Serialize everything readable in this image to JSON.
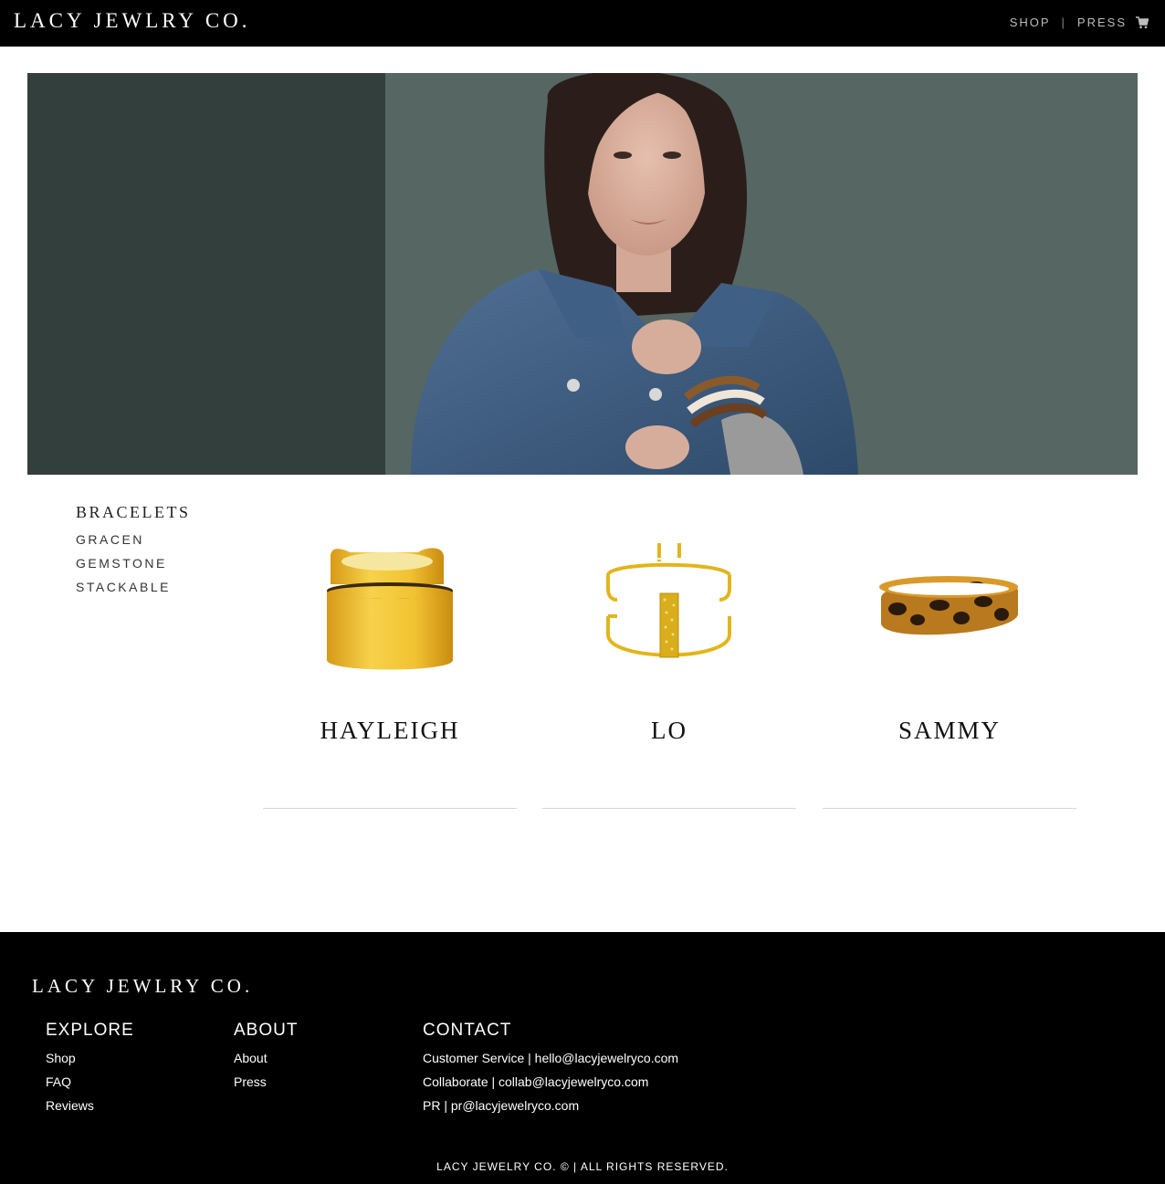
{
  "header": {
    "brand": "LACY JEWLRY CO.",
    "nav": {
      "shop": "SHOP",
      "separator": "|",
      "press": "PRESS",
      "cart_icon": "cart-icon"
    }
  },
  "hero": {
    "image": "woman-in-denim-jacket-wearing-bracelets",
    "colors": {
      "left_panel": "#333f3c",
      "background": "#566663"
    }
  },
  "categories": {
    "title": "BRACELETS",
    "items": [
      "GRACEN",
      "GEMSTONE",
      "STACKABLE"
    ]
  },
  "products": [
    {
      "name": "HAYLEIGH",
      "image": "gold-double-cuff-bracelet"
    },
    {
      "name": "LO",
      "image": "gold-open-bar-cuff-bracelet"
    },
    {
      "name": "SAMMY",
      "image": "tortoiseshell-cuff-bracelet"
    }
  ],
  "footer": {
    "brand": "LACY JEWLRY CO.",
    "explore": {
      "heading": "EXPLORE",
      "links": [
        "Shop",
        "FAQ",
        "Reviews"
      ]
    },
    "about": {
      "heading": "ABOUT",
      "links": [
        "About",
        "Press"
      ]
    },
    "contact": {
      "heading": "CONTACT",
      "links": [
        "Customer Service | hello@lacyjewelryco.com",
        "Collaborate | collab@lacyjewelryco.com",
        "PR | pr@lacyjewelryco.com"
      ]
    },
    "copyright": "LACY JEWELRY CO. © | ALL RIGHTS RESERVED."
  }
}
